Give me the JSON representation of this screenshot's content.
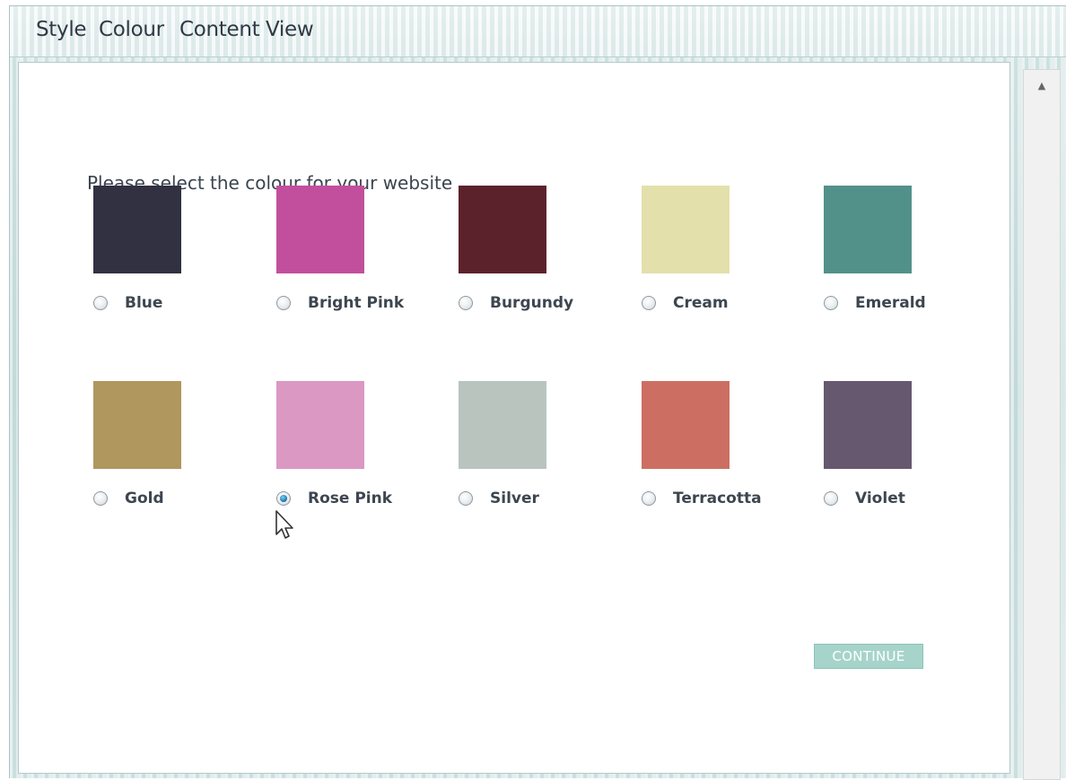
{
  "menu": {
    "items": [
      {
        "label": "Style"
      },
      {
        "label": "Colour"
      },
      {
        "label": "Content"
      },
      {
        "label": "View"
      }
    ]
  },
  "prompt": "Please select the colour for your website",
  "colours": [
    {
      "label": "Blue",
      "hex": "#323142",
      "checked": false
    },
    {
      "label": "Bright Pink",
      "hex": "#c24f9d",
      "checked": false
    },
    {
      "label": "Burgundy",
      "hex": "#5c222c",
      "checked": false
    },
    {
      "label": "Cream",
      "hex": "#e3e0ab",
      "checked": false
    },
    {
      "label": "Emerald",
      "hex": "#52918a",
      "checked": false
    },
    {
      "label": "Gold",
      "hex": "#b0975d",
      "checked": false
    },
    {
      "label": "Rose Pink",
      "hex": "#db98c3",
      "checked": true
    },
    {
      "label": "Silver",
      "hex": "#b9c4bf",
      "checked": false
    },
    {
      "label": "Terracotta",
      "hex": "#cc6f62",
      "checked": false
    },
    {
      "label": "Violet",
      "hex": "#66586f",
      "checked": false
    }
  ],
  "continue_label": "CONTINUE",
  "accent": "#a6d4ca",
  "icons": {
    "scroll_up": "triangle-up-icon",
    "cursor": "arrow-pointer-icon"
  }
}
